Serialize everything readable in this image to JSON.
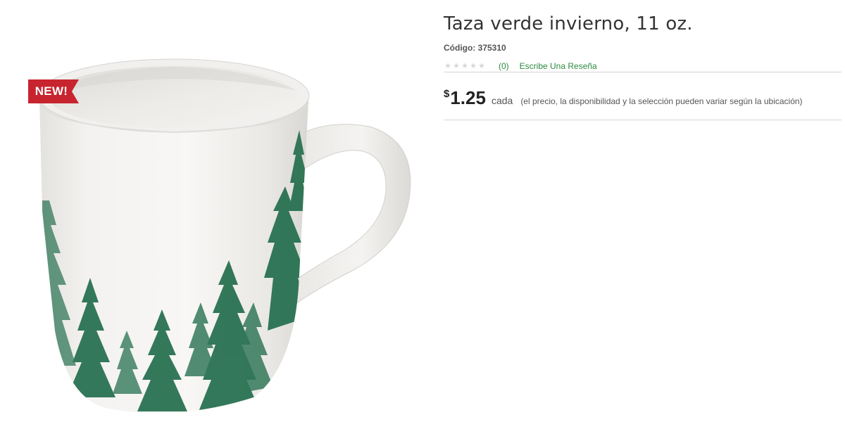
{
  "product": {
    "title": "Taza verde invierno, 11 oz.",
    "code": "Código: 375310",
    "badge": "NEW!",
    "image_alt": "mug with green pine trees",
    "colors": {
      "badge": "#c8242f",
      "link": "#2d8a3f",
      "tree": "#1f6b4a"
    }
  },
  "rating": {
    "stars_filled": 0,
    "stars_total": 5,
    "count": "(0)",
    "write_review": "Escribe Una Reseña"
  },
  "price": {
    "currency": "$",
    "value": "1.25",
    "unit": "cada",
    "note": "(el precio, la disponibilidad y la selección pueden variar según la ubicación)"
  }
}
